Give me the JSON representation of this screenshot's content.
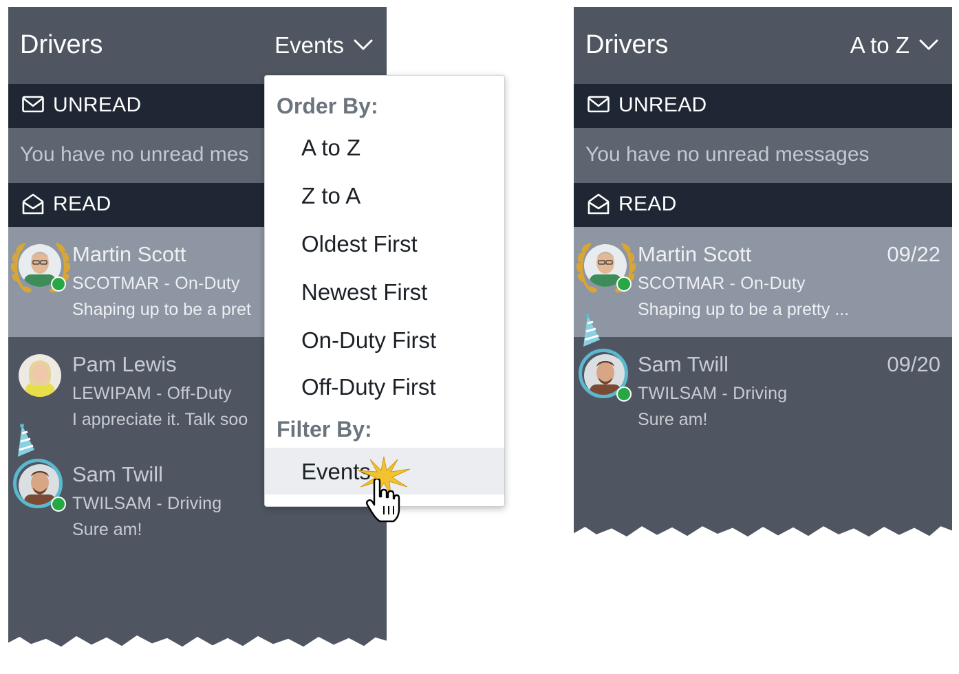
{
  "left_panel": {
    "title": "Drivers",
    "sort_label": "Events",
    "unread_label": "UNREAD",
    "unread_empty": "You have no unread mes",
    "read_label": "READ",
    "messages": [
      {
        "name": "Martin Scott",
        "sub": "SCOTMAR - On-Duty",
        "preview": "Shaping up to be a pret"
      },
      {
        "name": "Pam Lewis",
        "sub": "LEWIPAM - Off-Duty",
        "preview": "I appreciate it. Talk soo"
      },
      {
        "name": "Sam Twill",
        "sub": "TWILSAM - Driving",
        "preview": "Sure am!"
      }
    ]
  },
  "dropdown": {
    "order_header": "Order By:",
    "order_items": [
      "A to Z",
      "Z to A",
      "Oldest First",
      "Newest First",
      "On-Duty First",
      "Off-Duty First"
    ],
    "filter_header": "Filter By:",
    "filter_items": [
      "Events"
    ],
    "active_item": "Events"
  },
  "right_panel": {
    "title": "Drivers",
    "sort_label": "A to Z",
    "unread_label": "UNREAD",
    "unread_empty": "You have no unread messages",
    "read_label": "READ",
    "messages": [
      {
        "name": "Martin Scott",
        "sub": "SCOTMAR - On-Duty",
        "preview": "Shaping up to be a pretty ...",
        "date": "09/22"
      },
      {
        "name": "Sam Twill",
        "sub": "TWILSAM - Driving",
        "preview": "Sure am!",
        "date": "09/20"
      }
    ]
  },
  "colors": {
    "panel": "#4f5661",
    "section_bar": "#1e2733",
    "selected_row": "#8d96a2",
    "online": "#28a745",
    "event_ring": "#5bb9cf",
    "award_laurel": "#d9a635"
  },
  "icons": [
    "chevron-down-icon",
    "envelope-closed-icon",
    "envelope-open-icon",
    "laurel-award-icon",
    "party-hat-icon",
    "pointer-hand-icon",
    "click-burst-icon"
  ]
}
